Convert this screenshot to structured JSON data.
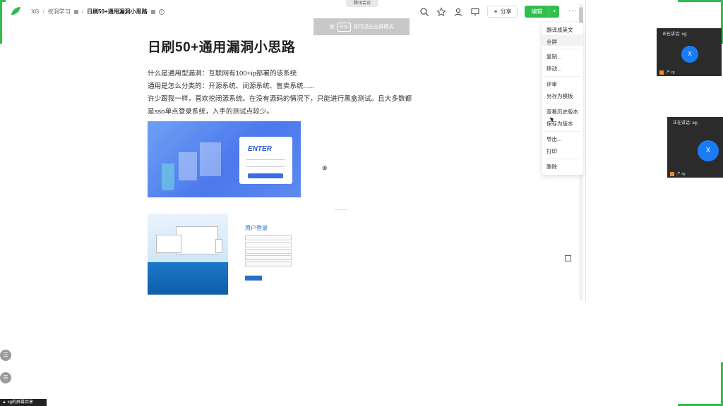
{
  "breadcrumb": {
    "workspace": "XG",
    "folder": "挖洞学习",
    "document": "日刷50+通用漏洞小思路"
  },
  "toolbar": {
    "share_label": "分享",
    "edit_label": "编辑",
    "more_glyph": "···"
  },
  "meeting": {
    "pill_label": "腾讯会议",
    "esc_prefix": "按",
    "esc_key": "Esc",
    "esc_suffix": "即可退出全屏模式"
  },
  "document": {
    "title": "日刷50+通用漏洞小思路",
    "paragraphs": [
      "什么是通用型漏洞：互联网有100+ip部署的该系统",
      "通用是怎么分类的：开源系统、闭源系统、售卖系统......",
      "许少跟我一样，喜欢挖闭源系统。在没有源码的情况下，只能进行黑盒测试。且大多数都",
      "是sso单点登录系统，入手的测试点较少。"
    ],
    "image1": {
      "brand": "ENTER"
    },
    "image2": {
      "login_title": "用户登录"
    }
  },
  "menu": {
    "items": [
      "翻译成英文",
      "全屏",
      "复制...",
      "移动...",
      "评审",
      "另存为模板",
      "查看历史版本",
      "保存为版本",
      "导出...",
      "打印",
      "删除"
    ]
  },
  "participants": [
    {
      "speaking_label": "正在讲话: xg;",
      "initial": "X",
      "name": "xg"
    },
    {
      "speaking_label": "正在讲话: xg;",
      "initial": "X",
      "name": "xg"
    }
  ],
  "status": {
    "sharing_label": "xg的屏幕共享"
  },
  "colors": {
    "accent": "#2fbf4a",
    "avatar": "#1a7cf5"
  }
}
